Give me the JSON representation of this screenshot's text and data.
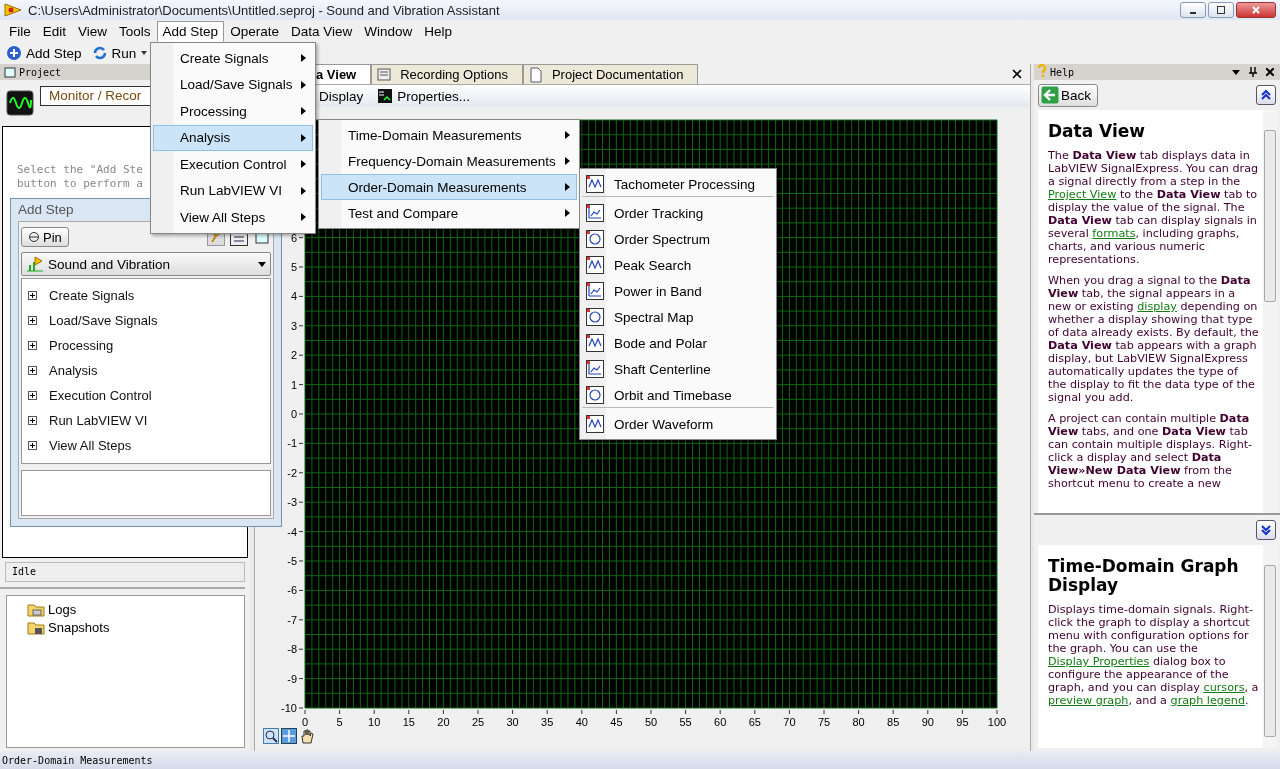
{
  "window": {
    "title": "C:\\Users\\Administrator\\Documents\\Untitled.seproj - Sound and Vibration Assistant"
  },
  "menu_bar": [
    {
      "label": "File",
      "selected": false
    },
    {
      "label": "Edit",
      "selected": false
    },
    {
      "label": "View",
      "selected": false
    },
    {
      "label": "Tools",
      "selected": false
    },
    {
      "label": "Add Step",
      "selected": true
    },
    {
      "label": "Operate",
      "selected": false
    },
    {
      "label": "Data View",
      "selected": false
    },
    {
      "label": "Window",
      "selected": false
    },
    {
      "label": "Help",
      "selected": false
    }
  ],
  "toolbar": [
    {
      "label": "Add Step",
      "kind": "add"
    },
    {
      "label": "Run",
      "kind": "run"
    }
  ],
  "project_pane": {
    "title": "Project",
    "mode_field": "Monitor / Recor",
    "hint_lines": [
      "Select the \"Add Ste",
      "button to perform a"
    ],
    "status_field": "Idle",
    "tree": [
      {
        "label": "Logs",
        "kind": "logs"
      },
      {
        "label": "Snapshots",
        "kind": "snapshots"
      }
    ]
  },
  "add_step_window": {
    "title": "Add Step",
    "pin_button": "Pin",
    "palette": "Sound and Vibration",
    "steps": [
      {
        "label": "Create Signals",
        "expanded": false
      },
      {
        "label": "Load/Save Signals",
        "expanded": false
      },
      {
        "label": "Processing",
        "expanded": false
      },
      {
        "label": "Analysis",
        "expanded": false
      },
      {
        "label": "Execution Control",
        "expanded": false
      },
      {
        "label": "Run LabVIEW VI",
        "expanded": false
      },
      {
        "label": "View All Steps",
        "expanded": false
      }
    ]
  },
  "tabs": [
    {
      "label": "a View",
      "selected": true
    },
    {
      "label": "Recording Options",
      "selected": false
    },
    {
      "label": "Project Documentation",
      "selected": false
    }
  ],
  "view_toolbar": [
    "Display",
    "Properties..."
  ],
  "graph": {
    "chart_data": {
      "type": "line",
      "grid": true,
      "xlim": [
        0,
        100
      ],
      "ylim": [
        -10,
        10
      ],
      "xticks": [
        0,
        5,
        10,
        15,
        20,
        25,
        30,
        35,
        40,
        45,
        50,
        55,
        60,
        65,
        70,
        75,
        80,
        85,
        90,
        95,
        100
      ],
      "yticks": [
        6,
        5,
        4,
        3,
        2,
        1,
        0,
        -1,
        -2,
        -3,
        -4,
        -5,
        -6,
        -7,
        -8,
        -9,
        -10
      ]
    }
  },
  "menus": [
    {
      "items": [
        {
          "label": "Create Signals",
          "selected": false
        },
        {
          "label": "Load/Save Signals",
          "selected": false
        },
        {
          "label": "Processing",
          "selected": false
        },
        {
          "label": "Analysis",
          "selected": true
        },
        {
          "label": "Execution Control",
          "selected": false
        },
        {
          "label": "Run LabVIEW VI",
          "selected": false
        },
        {
          "label": "View All Steps",
          "selected": false
        }
      ]
    },
    {
      "items": [
        {
          "label": "Time-Domain Measurements",
          "selected": false
        },
        {
          "label": "Frequency-Domain Measurements",
          "selected": false
        },
        {
          "label": "Order-Domain Measurements",
          "selected": true
        },
        {
          "label": "Test and Compare",
          "selected": false
        }
      ]
    },
    {
      "items": [
        {
          "label": "Tachometer Processing",
          "divider_after": true
        },
        {
          "label": "Order Tracking",
          "divider_after": false
        },
        {
          "label": "Order Spectrum",
          "divider_after": false
        },
        {
          "label": "Peak Search",
          "divider_after": false
        },
        {
          "label": "Power in Band",
          "divider_after": false
        },
        {
          "label": "Spectral Map",
          "divider_after": false
        },
        {
          "label": "Bode and Polar",
          "divider_after": false
        },
        {
          "label": "Shaft Centerline",
          "divider_after": false
        },
        {
          "label": "Orbit and Timebase",
          "divider_after": true
        },
        {
          "label": "Order Waveform",
          "divider_after": false
        }
      ]
    }
  ],
  "help": {
    "title": "Help",
    "back_button": "Back",
    "topics": [
      {
        "heading": "Data View",
        "paragraphs": [
          [
            {
              "kind": "text",
              "text": "The **Data View** tab displays data in LabVIEW SignalExpress. You can drag a signal directly from a step in the "
            },
            {
              "kind": "link",
              "text": "Project View"
            },
            {
              "kind": "text",
              "text": " to the **Data View** tab to display the value of the signal. The **Data View** tab can display signals in several "
            },
            {
              "kind": "link",
              "text": "formats"
            },
            {
              "kind": "text",
              "text": ", including graphs, charts, and various numeric representations."
            }
          ],
          [
            {
              "kind": "text",
              "text": "When you drag a signal to the **Data View** tab, the signal appears in a new or existing "
            },
            {
              "kind": "link",
              "text": "display"
            },
            {
              "kind": "text",
              "text": " depending on whether a display showing that type of data already exists. By default, the **Data View** tab appears with a graph display, but LabVIEW SignalExpress automatically updates the type of the display to fit the data type of the signal you add."
            }
          ],
          [
            {
              "kind": "text",
              "text": "A project can contain multiple **Data View** tabs, and one **Data View** tab can contain multiple displays. Right-click a display and select **Data View»New Data View** from the shortcut menu to create a new"
            }
          ]
        ]
      },
      {
        "heading": "Time-Domain Graph Display",
        "paragraphs": [
          [
            {
              "kind": "text",
              "text": "Displays time-domain signals. Right-click the graph to display a shortcut menu with configuration options for the graph. You can use the "
            },
            {
              "kind": "link",
              "text": "Display Properties"
            },
            {
              "kind": "text",
              "text": " dialog box to configure the appearance of the graph, and you can display "
            },
            {
              "kind": "link",
              "text": "cursors"
            },
            {
              "kind": "text",
              "text": ", a "
            },
            {
              "kind": "link",
              "text": "preview graph"
            },
            {
              "kind": "text",
              "text": ", and a "
            },
            {
              "kind": "link",
              "text": "graph legend"
            },
            {
              "kind": "text",
              "text": "."
            }
          ]
        ]
      }
    ]
  },
  "status_bar": "Order-Domain Measurements"
}
